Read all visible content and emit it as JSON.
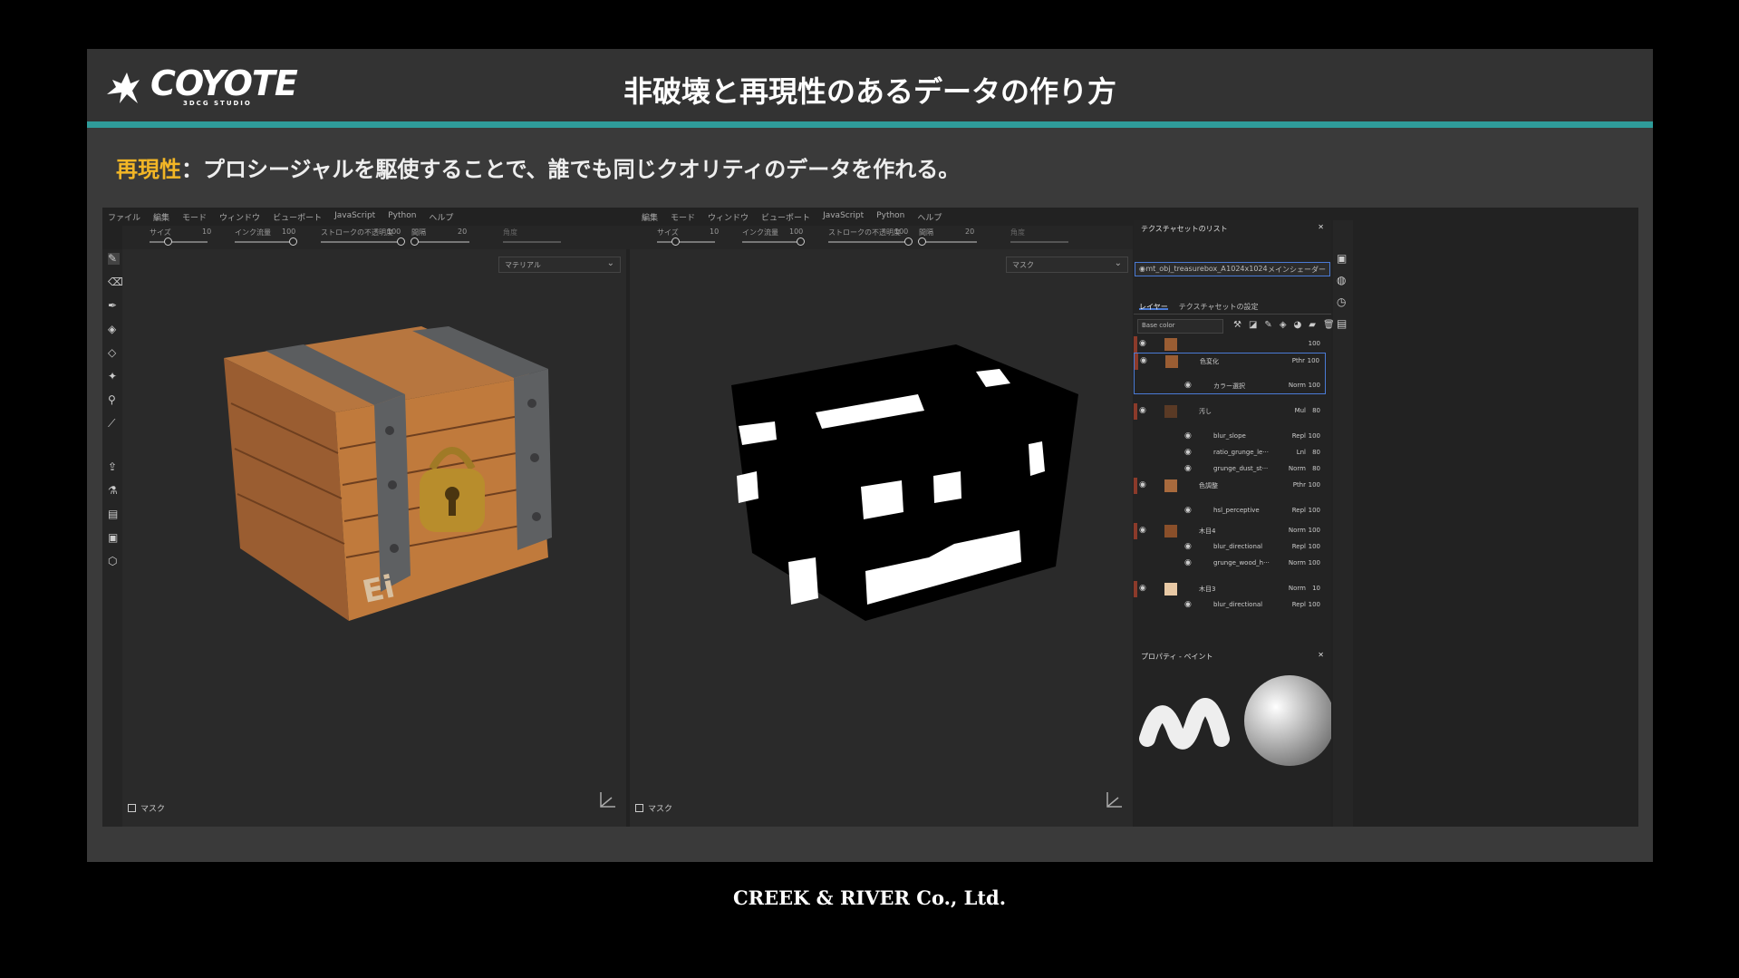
{
  "slide": {
    "title": "非破壊と再現性のあるデータの作り方",
    "subtitle_highlight": "再現性",
    "subtitle_rest": "：プロシージャルを駆使することで、誰でも同じクオリティのデータを作れる。",
    "logo_main": "COYOTE",
    "logo_sub": "3DCG STUDIO",
    "footer": "CREEK & RIVER Co., Ltd."
  },
  "app": {
    "menu_left": [
      "ファイル",
      "編集",
      "モード",
      "ウィンドウ",
      "ビューポート",
      "JavaScript",
      "Python",
      "ヘルプ"
    ],
    "menu_right": [
      "編集",
      "モード",
      "ウィンドウ",
      "ビューポート",
      "JavaScript",
      "Python",
      "ヘルプ"
    ],
    "toolbar": {
      "size_label": "サイズ",
      "size_value": "10",
      "flow_label": "インク流量",
      "flow_value": "100",
      "opacity_label": "ストロークの不透明度",
      "opacity_value": "100",
      "spacing_label": "間隔",
      "spacing_value": "20",
      "angle_label": "角度"
    },
    "viewport_left": {
      "dropdown": "マテリアル",
      "mask_label": "マスク"
    },
    "viewport_right": {
      "dropdown": "マスク",
      "mask_label": "マスク"
    },
    "texset_list": {
      "title": "テクスチャセットのリスト",
      "name": "mt_obj_treasurebox_A",
      "resolution": "1024x1024",
      "shader": "メインシェーダー"
    },
    "tabs": {
      "layers": "レイヤー",
      "texset_settings": "テクスチャセットの設定"
    },
    "channel": "Base color",
    "layers": [
      {
        "name": "",
        "blend": "",
        "opacity": "100",
        "swatch": "#9a5d33"
      },
      {
        "name": "色変化",
        "blend": "Pthr",
        "opacity": "100",
        "swatch": "#9a5d33"
      },
      {
        "name": "カラー選択",
        "blend": "Norm",
        "opacity": "100",
        "swatch": ""
      },
      {
        "name": "汚し",
        "blend": "Mul",
        "opacity": "80",
        "swatch": "#5a3a25"
      },
      {
        "name": "blur_slope",
        "blend": "Repl",
        "opacity": "100",
        "swatch": ""
      },
      {
        "name": "ratio_grunge_le···",
        "blend": "Lnl",
        "opacity": "80",
        "swatch": ""
      },
      {
        "name": "grunge_dust_st···",
        "blend": "Norm",
        "opacity": "80",
        "swatch": ""
      },
      {
        "name": "色調整",
        "blend": "Pthr",
        "opacity": "100",
        "swatch": "#a86a3d"
      },
      {
        "name": "hsl_perceptive",
        "blend": "Repl",
        "opacity": "100",
        "swatch": ""
      },
      {
        "name": "木目4",
        "blend": "Norm",
        "opacity": "100",
        "swatch": "#8a4f2a"
      },
      {
        "name": "blur_directional",
        "blend": "Repl",
        "opacity": "100",
        "swatch": ""
      },
      {
        "name": "grunge_wood_h···",
        "blend": "Norm",
        "opacity": "100",
        "swatch": ""
      },
      {
        "name": "木目3",
        "blend": "Norm",
        "opacity": "10",
        "swatch": "#e8c9a5"
      },
      {
        "name": "blur_directional",
        "blend": "Repl",
        "opacity": "100",
        "swatch": ""
      }
    ],
    "properties_title": "プロパティ - ペイント"
  },
  "colors": {
    "accent": "#2f9c9a",
    "highlight": "#f2b626",
    "selection": "#4a7bd6"
  }
}
